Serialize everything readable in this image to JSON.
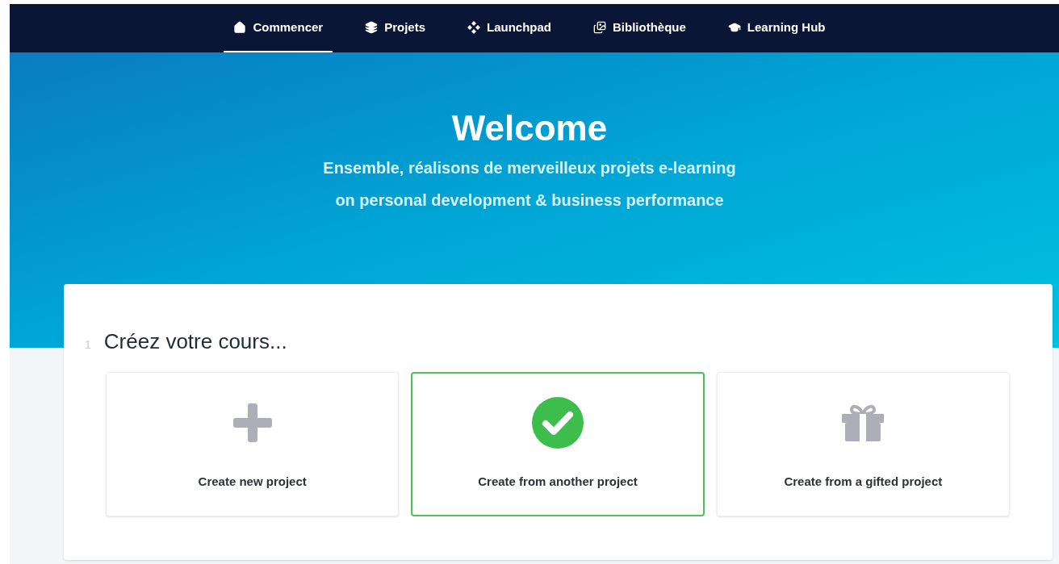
{
  "nav": [
    {
      "label": "Commencer",
      "kind": "home",
      "selected": true
    },
    {
      "label": "Projets",
      "kind": "layers",
      "selected": false
    },
    {
      "label": "Launchpad",
      "kind": "diamonds",
      "selected": false
    },
    {
      "label": "Bibliothèque",
      "kind": "images",
      "selected": false
    },
    {
      "label": "Learning Hub",
      "kind": "cap",
      "selected": false
    }
  ],
  "hero": {
    "title": "Welcome",
    "subtitle_lines": [
      "Ensemble, réalisons de merveilleux projets e-learning",
      "on personal development & business performance"
    ]
  },
  "step": {
    "number": "1",
    "title": "Créez votre cours..."
  },
  "options": [
    {
      "label": "Create new project",
      "kind": "plus",
      "selected": false
    },
    {
      "label": "Create from another project",
      "kind": "check",
      "selected": true
    },
    {
      "label": "Create from a gifted project",
      "kind": "gift",
      "selected": false
    }
  ]
}
